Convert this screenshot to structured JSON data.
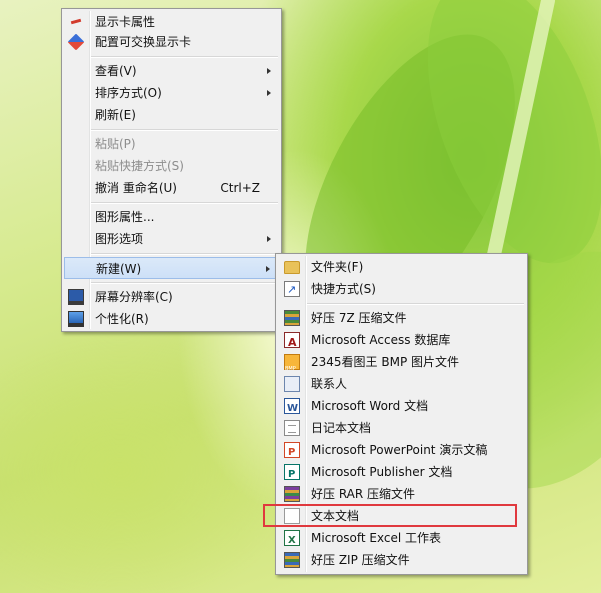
{
  "desktop": {
    "wallpaper": "green leaves"
  },
  "context_menu": {
    "display_properties": "显示卡属性",
    "switchable_graphics": "配置可交换显示卡",
    "view": "查看(V)",
    "sort_by": "排序方式(O)",
    "refresh": "刷新(E)",
    "paste": "粘贴(P)",
    "paste_shortcut": "粘贴快捷方式(S)",
    "undo_rename": "撤消 重命名(U)",
    "undo_shortcut": "Ctrl+Z",
    "graphics_properties": "图形属性...",
    "graphics_options": "图形选项",
    "new": "新建(W)",
    "screen_resolution": "屏幕分辨率(C)",
    "personalize": "个性化(R)"
  },
  "new_submenu": {
    "folder": "文件夹(F)",
    "shortcut": "快捷方式(S)",
    "haozip_7z": "好压 7Z 压缩文件",
    "access_db": "Microsoft Access 数据库",
    "bmp_image": "2345看图王 BMP 图片文件",
    "contact": "联系人",
    "word_doc": "Microsoft Word 文档",
    "journal_doc": "日记本文档",
    "ppt": "Microsoft PowerPoint 演示文稿",
    "publisher": "Microsoft Publisher 文档",
    "haozip_rar": "好压 RAR 压缩文件",
    "text_doc": "文本文档",
    "excel": "Microsoft Excel 工作表",
    "haozip_zip": "好压 ZIP 压缩文件"
  },
  "colors": {
    "menu_bg": "#f0f0f0",
    "hover_bg": "#cde0f7",
    "hover_border": "#9cbde9",
    "highlight_box": "#e0393e",
    "disabled_text": "#8d8d8d"
  }
}
